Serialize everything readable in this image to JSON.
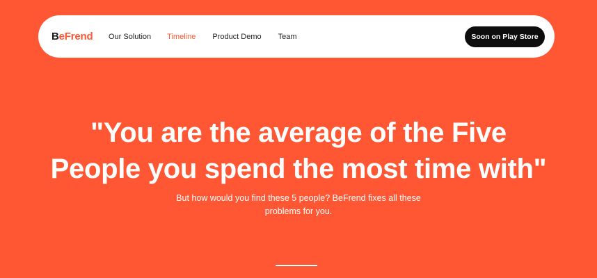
{
  "brand": {
    "logo_initial": "B",
    "logo_rest": "eFrend"
  },
  "nav": {
    "links": [
      {
        "label": "Our Solution",
        "active": false
      },
      {
        "label": "Timeline",
        "active": true
      },
      {
        "label": "Product Demo",
        "active": false
      },
      {
        "label": "Team",
        "active": false
      }
    ],
    "cta_label": "Soon on Play Store"
  },
  "hero": {
    "title": "\"You are the average of the Five People you spend the most time with\"",
    "subtitle": "But how would you find these 5 people? BeFrend fixes all these problems for you."
  },
  "colors": {
    "accent": "#ff5733",
    "nav_background": "#ffffff",
    "cta_background": "#0d0d0d",
    "text_light": "#ffffff",
    "text_dark": "#222222"
  }
}
